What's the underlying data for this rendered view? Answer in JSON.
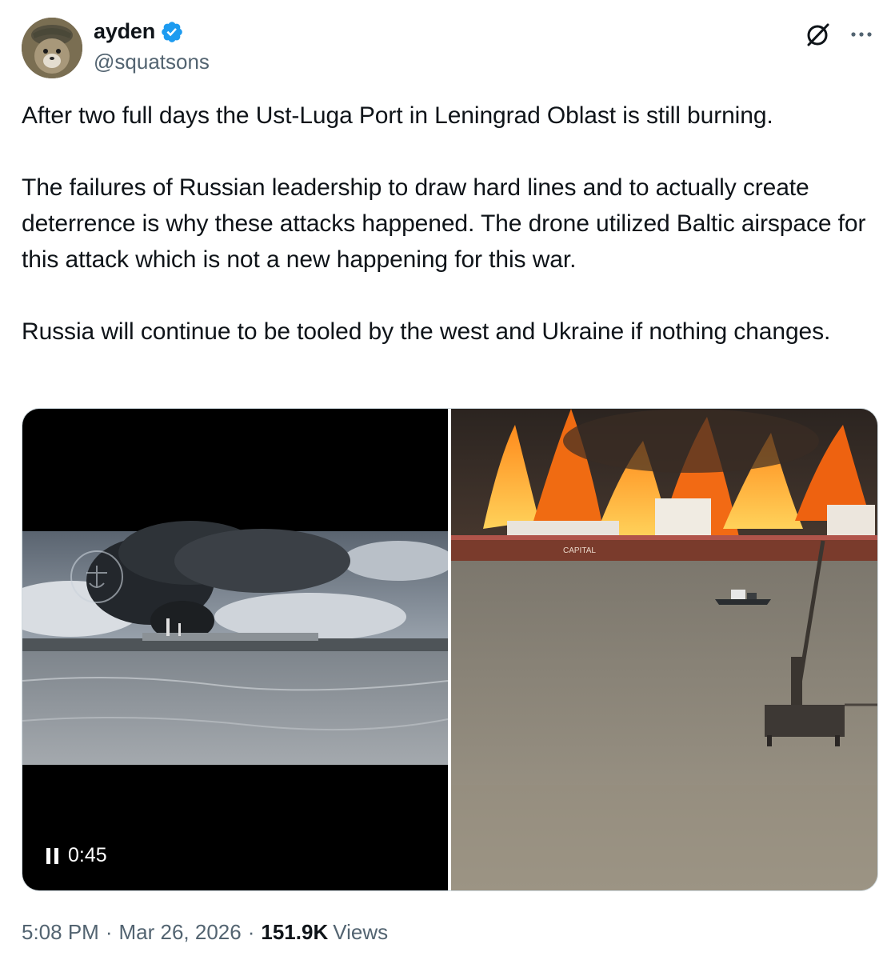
{
  "author": {
    "display_name": "ayden",
    "handle": "@squatsons",
    "verified": true,
    "verified_color": "#1d9bf0"
  },
  "toolbar": {
    "grok_icon": "grok-slash-circle-icon",
    "more_icon": "more-ellipsis-icon"
  },
  "tweet": {
    "paragraphs": [
      "After two full days the Ust-Luga Port in Leningrad Oblast is still burning.",
      "The failures of Russian leadership to draw hard lines and to actually create deterrence is why these attacks happened. The drone utilized Baltic airspace for this attack which is not a new happening for this war.",
      "Russia will continue to be tooled by the west and Ukraine if nothing changes."
    ]
  },
  "media": {
    "video": {
      "state_icon": "pause-icon",
      "duration": "0:45"
    },
    "photo": {
      "ship_name": "CAPITAL"
    }
  },
  "meta": {
    "time": "5:08 PM",
    "separator": "·",
    "date": "Mar 26, 2026",
    "views_count": "151.9K",
    "views_label": "Views"
  },
  "colors": {
    "text": "#0f1419",
    "secondary": "#536471",
    "border": "#cfd9de"
  }
}
